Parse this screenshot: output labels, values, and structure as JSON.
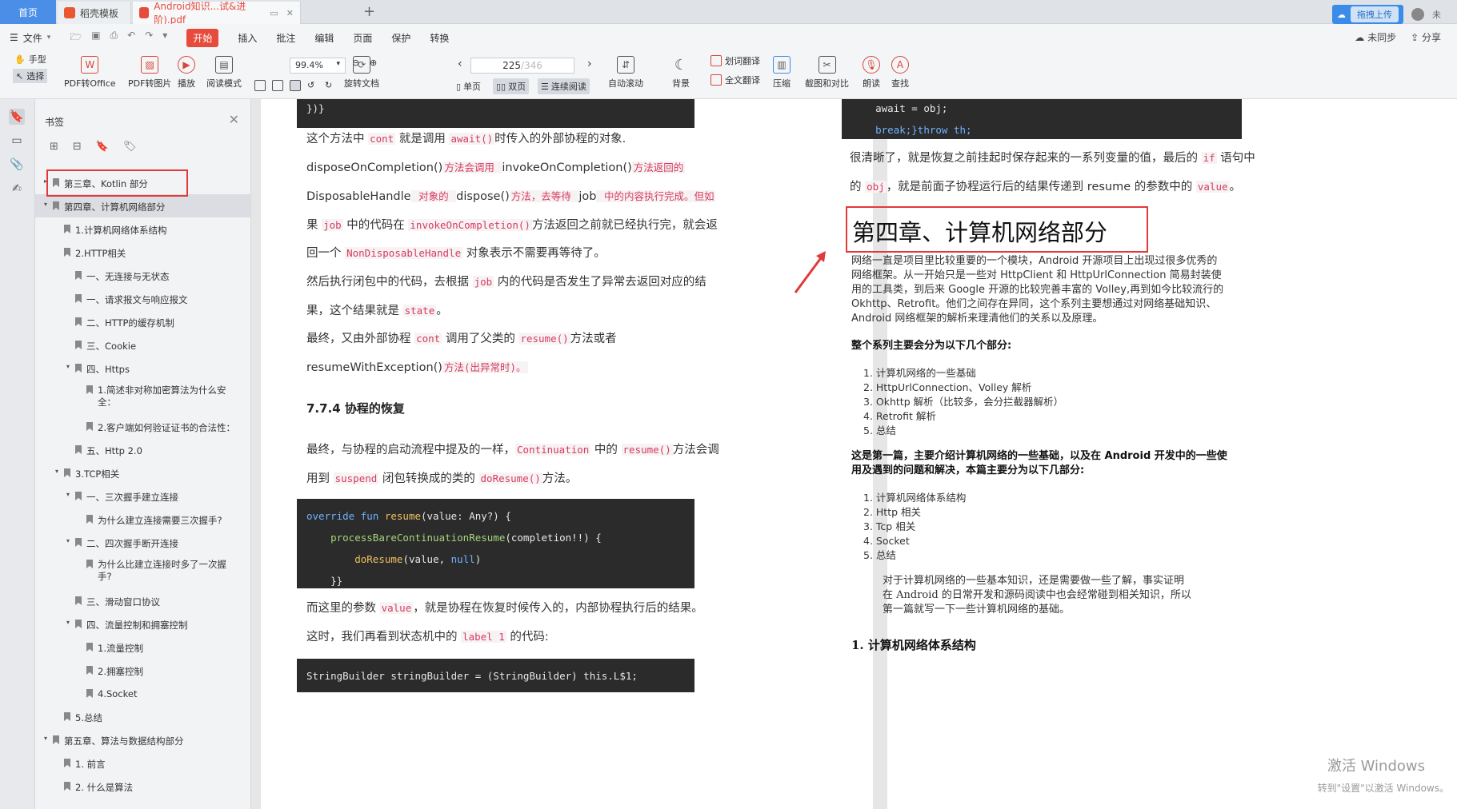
{
  "tabs": {
    "home": "首页",
    "t1": "稻壳模板",
    "t2": "Android知识...试&进阶).pdf"
  },
  "top_right": {
    "upload": "拖拽上传",
    "user": "未"
  },
  "menu": {
    "file": "文件",
    "items": [
      "开始",
      "插入",
      "批注",
      "编辑",
      "页面",
      "保护",
      "转换"
    ],
    "sync": "未同步",
    "share": "分享"
  },
  "ribbon": {
    "hand": "手型",
    "select": "选择",
    "pdf2office": "PDF转Office",
    "pdf2img": "PDF转图片",
    "play": "播放",
    "read": "阅读模式",
    "zoom": "99.4%",
    "rotate": "旋转文档",
    "page_current": "225",
    "page_total": "/346",
    "single": "单页",
    "double": "双页",
    "continuous": "连续阅读",
    "autoscroll": "自动滚动",
    "background": "背景",
    "word_translate": "划词翻译",
    "full_translate": "全文翻译",
    "compress": "压缩",
    "screenshot": "截图和对比",
    "read_aloud": "朗读",
    "find": "查找"
  },
  "bookmarks": {
    "title": "书签",
    "items": [
      {
        "label": "第三章、Kotlin 部分"
      },
      {
        "label": "第四章、计算机网络部分"
      },
      {
        "label": "1.计算机网络体系结构"
      },
      {
        "label": "2.HTTP相关"
      },
      {
        "label": "一、无连接与无状态"
      },
      {
        "label": "一、请求报文与响应报文"
      },
      {
        "label": "二、HTTP的缓存机制"
      },
      {
        "label": "三、Cookie"
      },
      {
        "label": "四、Https"
      },
      {
        "label": "1.简述非对称加密算法为什么安全："
      },
      {
        "label": "2.客户端如何验证证书的合法性："
      },
      {
        "label": "五、Http 2.0"
      },
      {
        "label": "3.TCP相关"
      },
      {
        "label": "一、三次握手建立连接"
      },
      {
        "label": "为什么建立连接需要三次握手?"
      },
      {
        "label": "二、四次握手断开连接"
      },
      {
        "label": "为什么比建立连接时多了一次握手?"
      },
      {
        "label": "三、滑动窗口协议"
      },
      {
        "label": "四、流量控制和拥塞控制"
      },
      {
        "label": "1.流量控制"
      },
      {
        "label": "2.拥塞控制"
      },
      {
        "label": "4.Socket"
      },
      {
        "label": "5.总结"
      },
      {
        "label": "第五章、算法与数据结构部分"
      },
      {
        "label": "1. 前言"
      },
      {
        "label": "2. 什么是算法"
      }
    ]
  },
  "page1": {
    "code_top": "})}",
    "p1": [
      "这个方法中 ",
      "cont",
      " 就是调用 ",
      "await()",
      "时传入的外部协程的对象."
    ],
    "p2": [
      "disposeOnCompletion()",
      "方法会调用 ",
      "invokeOnCompletion()",
      "方法返回的"
    ],
    "p3": [
      "DisposableHandle",
      " 对象的 ",
      "dispose()",
      "方法，去等待 ",
      "job",
      " 中的内容执行完成。但如"
    ],
    "p4": [
      "果 ",
      "job",
      " 中的代码在 ",
      "invokeOnCompletion()",
      "方法返回之前就已经执行完，就会返"
    ],
    "p5": [
      "回一个 ",
      "NonDisposableHandle",
      " 对象表示不需要再等待了。"
    ],
    "p6": [
      "然后执行闭包中的代码，去根据 ",
      "job",
      " 内的代码是否发生了异常去返回对应的结"
    ],
    "p7": [
      "果，这个结果就是 ",
      "state",
      "。"
    ],
    "p8": [
      "最终，又由外部协程 ",
      "cont",
      " 调用了父类的 ",
      "resume()",
      "方法或者"
    ],
    "p9": [
      "resumeWithException()",
      "方法(出异常时)。"
    ],
    "h": "7.7.4  协程的恢复",
    "p10": [
      "最终，与协程的启动流程中提及的一样，",
      "Continuation",
      " 中的 ",
      "resume()",
      "方法会调"
    ],
    "p11": [
      "用到 ",
      "suspend",
      " 闭包转换成的类的 ",
      "doResume()",
      "方法。"
    ],
    "code2": [
      "override fun resume(value: Any?) {",
      "    processBareContinuationResume(completion!!) {",
      "        doResume(value, null)",
      "    }}"
    ],
    "p12": [
      "而这里的参数 ",
      "value",
      "，就是协程在恢复时候传入的，内部协程执行后的结果。"
    ],
    "p13": [
      "这时，我们再看到状态机中的 ",
      "label 1",
      " 的代码:"
    ],
    "code3": "StringBuilder stringBuilder = (StringBuilder) this.L$1;"
  },
  "page2": {
    "code_lines": [
      "await = obj;",
      "break;}throw th;"
    ],
    "p1": [
      "很清晰了，就是恢复之前挂起时保存起来的一系列变量的值，最后的 ",
      "if",
      " 语句中"
    ],
    "p2": [
      "的 ",
      "obj",
      "，就是前面子协程运行后的结果传递到 resume 的参数中的 ",
      "value",
      "。"
    ],
    "title": "第四章、计算机网络部分",
    "intro": [
      "网络一直是项目里比较重要的一个模块，Android 开源项目上出现过很多优秀的",
      "网络框架。从一开始只是一些对 HttpClient 和 HttpUrlConnection 简易封装使",
      "用的工具类，到后来 Google 开源的比较完善丰富的 Volley,再到如今比较流行的",
      "Okhttp、Retrofit。他们之间存在异同，这个系列主要想通过对网络基础知识、",
      "Android 网络框架的解析来理清他们的关系以及原理。"
    ],
    "b1": "整个系列主要会分为以下几个部分:",
    "list1": [
      "计算机网络的一些基础",
      "HttpUrlConnection、Volley 解析",
      "Okhttp 解析（比较多，会分拦截器解析）",
      "Retrofit 解析",
      "总结"
    ],
    "b2": [
      "这是第一篇，主要介绍计算机网络的一些基础，以及在 Android 开发中的一些使",
      "用及遇到的问题和解决，本篇主要分为以下几部分:"
    ],
    "list2": [
      "计算机网络体系结构",
      "Http 相关",
      "Tcp 相关",
      "Socket",
      "总结"
    ],
    "p3": [
      "对于计算机网络的一些基本知识，还是需要做一些了解，事实证明",
      "在 Android 的日常开发和源码阅读中也会经常碰到相关知识，所以",
      "第一篇就写一下一些计算机网络的基础。"
    ],
    "section": "1. 计算机网络体系结构"
  },
  "watermark": {
    "line1": "激活 Windows",
    "line2": "转到\"设置\"以激活 Windows。"
  },
  "colors": {
    "accent": "#e64b3c",
    "highlight_box": "#e23a3a",
    "code_bg": "#2b2b2b",
    "inline_code": "#d63b5e"
  }
}
